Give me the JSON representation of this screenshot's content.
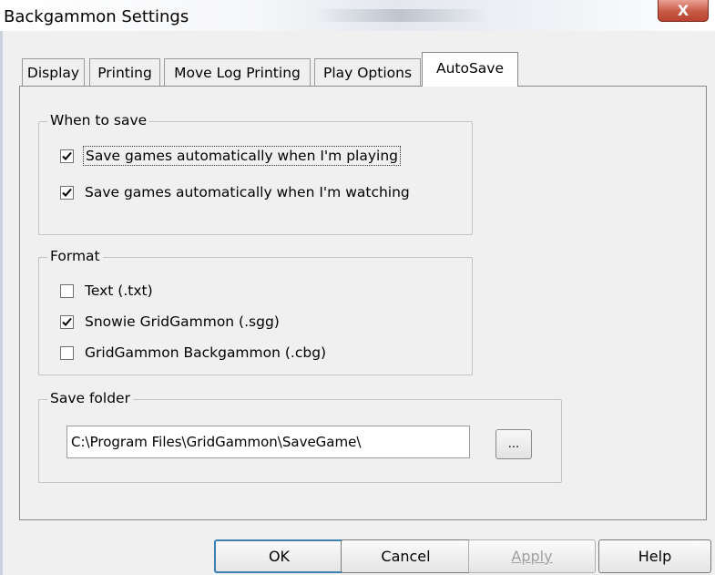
{
  "window": {
    "title": "Backgammon Settings",
    "close_label": "X"
  },
  "tabs": [
    {
      "label": "Display",
      "active": false
    },
    {
      "label": "Printing",
      "active": false
    },
    {
      "label": "Move Log Printing",
      "active": false
    },
    {
      "label": "Play Options",
      "active": false
    },
    {
      "label": "AutoSave",
      "active": true
    }
  ],
  "when_to_save": {
    "legend": "When to save",
    "options": [
      {
        "label": "Save games automatically when I'm playing",
        "checked": true
      },
      {
        "label": "Save games automatically when I'm watching",
        "checked": true
      }
    ]
  },
  "format": {
    "legend": "Format",
    "options": [
      {
        "label": "Text (.txt)",
        "checked": false
      },
      {
        "label": "Snowie GridGammon (.sgg)",
        "checked": true
      },
      {
        "label": "GridGammon Backgammon (.cbg)",
        "checked": false
      }
    ]
  },
  "save_folder": {
    "legend": "Save folder",
    "path": "C:\\Program Files\\GridGammon\\SaveGame\\",
    "browse_label": "..."
  },
  "buttons": {
    "ok": "OK",
    "cancel": "Cancel",
    "apply": "Apply",
    "help": "Help"
  },
  "colors": {
    "close_button": "#c75a46",
    "default_button_border": "#3c7fb1",
    "dialog_background": "#f0f0f0"
  },
  "icons": {
    "close": "close-icon",
    "checkmark": "checkmark-icon"
  }
}
